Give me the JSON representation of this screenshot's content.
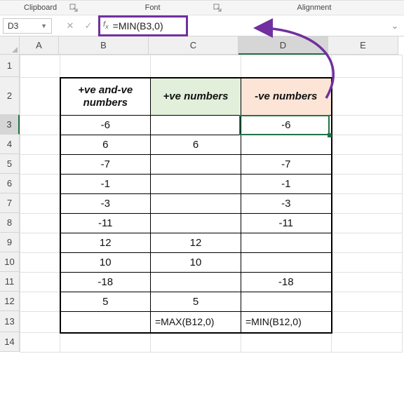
{
  "ribbon": {
    "group_left": "Clipboard",
    "group_mid": "Font",
    "group_right": "Alignment"
  },
  "namebox": {
    "value": "D3"
  },
  "formula": {
    "value": "=MIN(B3,0)"
  },
  "columns": {
    "A": "A",
    "B": "B",
    "C": "C",
    "D": "D",
    "E": "E"
  },
  "rows": {
    "r1": "1",
    "r2": "2",
    "r3": "3",
    "r4": "4",
    "r5": "5",
    "r6": "6",
    "r7": "7",
    "r8": "8",
    "r9": "9",
    "r10": "10",
    "r11": "11",
    "r12": "12",
    "r13": "13",
    "r14": "14"
  },
  "headers": {
    "B": "+ve and-ve numbers",
    "C": "+ve numbers",
    "D": "-ve numbers"
  },
  "cells": {
    "B3": "-6",
    "C3": "",
    "D3": "-6",
    "B4": "6",
    "C4": "6",
    "D4": "",
    "B5": "-7",
    "C5": "",
    "D5": "-7",
    "B6": "-1",
    "C6": "",
    "D6": "-1",
    "B7": "-3",
    "C7": "",
    "D7": "-3",
    "B8": "-11",
    "C8": "",
    "D8": "-11",
    "B9": "12",
    "C9": "12",
    "D9": "",
    "B10": "10",
    "C10": "10",
    "D10": "",
    "B11": "-18",
    "C11": "",
    "D11": "-18",
    "B12": "5",
    "C12": "5",
    "D12": "",
    "B13": "",
    "C13": "=MAX(B12,0)",
    "D13": "=MIN(B12,0)"
  },
  "chart_data": {
    "type": "table",
    "title": "",
    "columns": [
      "+ve and-ve numbers",
      "+ve numbers",
      "-ve numbers"
    ],
    "rows": [
      [
        -6,
        null,
        -6
      ],
      [
        6,
        6,
        null
      ],
      [
        -7,
        null,
        -7
      ],
      [
        -1,
        null,
        -1
      ],
      [
        -3,
        null,
        -3
      ],
      [
        -11,
        null,
        -11
      ],
      [
        12,
        12,
        null
      ],
      [
        10,
        10,
        null
      ],
      [
        -18,
        null,
        -18
      ],
      [
        5,
        5,
        null
      ]
    ],
    "formulas": {
      "C": "=MAX(B12,0)",
      "D": "=MIN(B12,0)"
    }
  },
  "colors": {
    "accent": "#7030A0",
    "select": "#217346",
    "headerGreen": "#E2EFDA",
    "headerRed": "#FCE4D6"
  }
}
